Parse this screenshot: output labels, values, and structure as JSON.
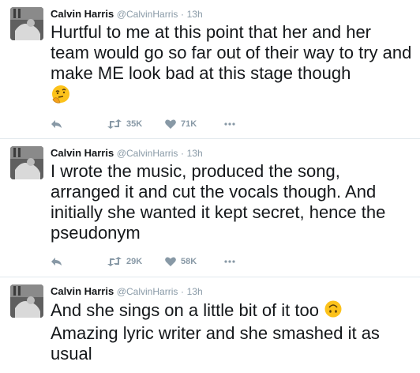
{
  "colors": {
    "text": "#14171a",
    "meta": "#8899a6",
    "divider": "#e1e8ed",
    "emoji": "#fcc21b"
  },
  "tweets": [
    {
      "name": "Calvin Harris",
      "handle": "@CalvinHarris",
      "separator": "·",
      "time": "13h",
      "text": "Hurtful to me at this point that her and her team would go so far out of their way to try and make ME look bad at this stage though",
      "emoji": "thinking-face-emoji",
      "retweets": "35K",
      "likes": "71K"
    },
    {
      "name": "Calvin Harris",
      "handle": "@CalvinHarris",
      "separator": "·",
      "time": "13h",
      "text": "I wrote the music, produced the song, arranged it and cut the vocals though. And initially she wanted it kept secret, hence the pseudonym",
      "retweets": "29K",
      "likes": "58K"
    },
    {
      "name": "Calvin Harris",
      "handle": "@CalvinHarris",
      "separator": "·",
      "time": "13h",
      "text_before_emoji": "And she sings on a little bit of it too",
      "emoji": "upside-down-face-emoji",
      "text_after_emoji": "Amazing lyric writer and she smashed it as usual"
    }
  ],
  "icons": {
    "reply": "reply-icon",
    "retweet": "retweet-icon",
    "like": "heart-icon",
    "more": "more-icon"
  }
}
